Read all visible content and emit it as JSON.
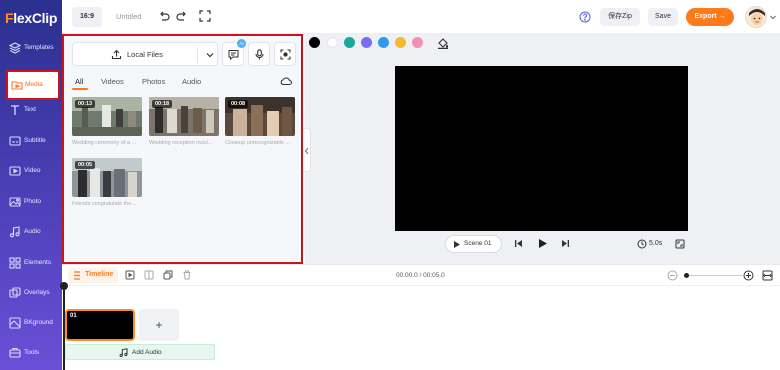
{
  "app": {
    "logo_text": "lexClip",
    "logo_letter": "F",
    "project_title": "Untitled"
  },
  "topbar": {
    "aspect_ratio": "16:9",
    "zip_label": "保存Zip",
    "save_label": "Save",
    "export_label": "Export →",
    "colors": {
      "export": "#ff7a1a"
    }
  },
  "sidebar": {
    "items": [
      {
        "label": "Templates",
        "icon": "templates-icon"
      },
      {
        "label": "Media",
        "icon": "media-icon",
        "active": true
      },
      {
        "label": "Text",
        "icon": "text-icon"
      },
      {
        "label": "Subtitle",
        "icon": "subtitle-icon"
      },
      {
        "label": "Video",
        "icon": "video-icon"
      },
      {
        "label": "Photo",
        "icon": "photo-icon"
      },
      {
        "label": "Audio",
        "icon": "audio-icon"
      },
      {
        "label": "Elements",
        "icon": "elements-icon"
      },
      {
        "label": "Overlays",
        "icon": "overlays-icon"
      },
      {
        "label": "BKground",
        "icon": "background-icon"
      },
      {
        "label": "Tools",
        "icon": "tools-icon"
      }
    ]
  },
  "media": {
    "local_files_label": "Local Files",
    "subtitle_badge": "AI",
    "tabs": [
      "All",
      "Videos",
      "Photos",
      "Audio"
    ],
    "active_tab": "All",
    "items": [
      {
        "duration": "00:13",
        "caption": "Wedding ceremony of a ..."
      },
      {
        "duration": "00:18",
        "caption": "Wedding reception outsi..."
      },
      {
        "duration": "00:08",
        "caption": "Closeup unrecognizable ..."
      },
      {
        "duration": "00:05",
        "caption": "Friends congratulate the..."
      }
    ]
  },
  "canvas": {
    "palette": [
      "#000000",
      "#ffffff",
      "#1aa89a",
      "#7b6cf6",
      "#2f9be6",
      "#f5b82e",
      "#f28fb3"
    ]
  },
  "player": {
    "scene_label": "Scene 01",
    "duration": "5.0s"
  },
  "timeline": {
    "label": "Timeline",
    "time_readout": "00:00.0 / 00:05.0",
    "clip_number": "01",
    "add_clip": "+",
    "add_audio_label": "Add Audio"
  }
}
